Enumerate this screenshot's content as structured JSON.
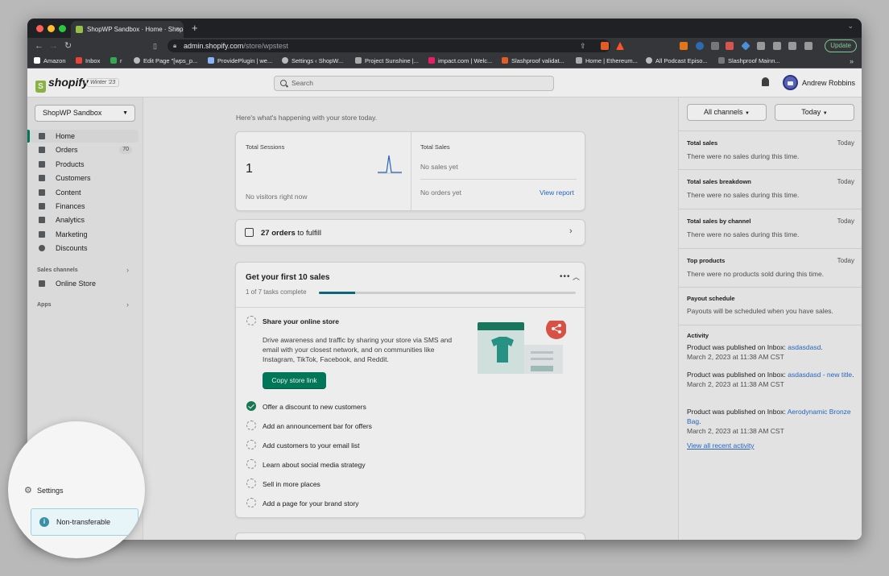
{
  "browser": {
    "tab_title": "ShopWP Sandbox · Home · Shop",
    "tab_close": "×",
    "new_tab": "+",
    "url_host": "admin.shopify.com",
    "url_path": "/store/wpstest",
    "update_label": "Update",
    "bookmarks": [
      "Amazon",
      "Inbox",
      "r",
      "Edit Page \"[wps_p...",
      "ProvidePlugin | we...",
      "Settings ‹ ShopW...",
      "Project Sunshine |...",
      "impact.com | Welc...",
      "Slashproof validat...",
      "Home | Ethereum...",
      "All Podcast Episo...",
      "Slashproof Mainn..."
    ],
    "more": "»"
  },
  "topbar": {
    "logo": "shopify",
    "edition": "Winter '23",
    "search_placeholder": "Search",
    "user_name": "Andrew Robbins"
  },
  "sidebar": {
    "store_name": "ShopWP Sandbox",
    "items": [
      {
        "label": "Home",
        "icon": "home-icon"
      },
      {
        "label": "Orders",
        "icon": "orders-icon",
        "count": "70"
      },
      {
        "label": "Products",
        "icon": "products-icon"
      },
      {
        "label": "Customers",
        "icon": "customers-icon"
      },
      {
        "label": "Content",
        "icon": "content-icon"
      },
      {
        "label": "Finances",
        "icon": "finances-icon"
      },
      {
        "label": "Analytics",
        "icon": "analytics-icon"
      },
      {
        "label": "Marketing",
        "icon": "marketing-icon"
      },
      {
        "label": "Discounts",
        "icon": "discounts-icon"
      }
    ],
    "sales_channels_label": "Sales channels",
    "online_store": "Online Store",
    "apps_label": "Apps",
    "settings": "Settings",
    "non_transferable": "Non-transferable"
  },
  "main": {
    "greeting": "Here's what's happening with your store today.",
    "sessions": {
      "label": "Total Sessions",
      "value": "1",
      "footer": "No visitors right now"
    },
    "sales": {
      "label": "Total Sales",
      "status": "No sales yet",
      "orders": "No orders yet",
      "view_report": "View report"
    },
    "fulfill": {
      "count": "27 orders",
      "suffix": "to fulfill"
    },
    "setup": {
      "title": "Get your first 10 sales",
      "progress_text": "1 of 7 tasks complete",
      "progress_pct": 14,
      "share_title": "Share your online store",
      "share_desc": "Drive awareness and traffic by sharing your store via SMS and email with your closest network, and on communities like Instagram, TikTok, Facebook, and Reddit.",
      "copy_button": "Copy store link",
      "tasks": [
        {
          "label": "Offer a discount to new customers",
          "done": true
        },
        {
          "label": "Add an announcement bar for offers",
          "done": false
        },
        {
          "label": "Add customers to your email list",
          "done": false
        },
        {
          "label": "Learn about social media strategy",
          "done": false
        },
        {
          "label": "Sell in more places",
          "done": false
        },
        {
          "label": "Add a page for your brand story",
          "done": false
        }
      ]
    }
  },
  "right": {
    "channels_button": "All channels",
    "date_button": "Today",
    "sections": [
      {
        "title": "Total sales",
        "period": "Today",
        "text": "There were no sales during this time."
      },
      {
        "title": "Total sales breakdown",
        "period": "Today",
        "text": "There were no sales during this time."
      },
      {
        "title": "Total sales by channel",
        "period": "Today",
        "text": "There were no sales during this time."
      },
      {
        "title": "Top products",
        "period": "Today",
        "text": "There were no products sold during this time."
      },
      {
        "title": "Payout schedule",
        "period": "",
        "text": "Payouts will be scheduled when you have sales."
      }
    ],
    "activity_title": "Activity",
    "activity": [
      {
        "prefix": "Product was published on Inbox:",
        "link": "asdasdasd",
        "end": ".",
        "date": "March 2, 2023 at 11:38 AM CST"
      },
      {
        "prefix": "Product was published on Inbox:",
        "link": "asdasdasd - new title",
        "end": ".",
        "date": "March 2, 2023 at 11:38 AM CST"
      },
      {
        "prefix": "Product was published on Inbox:",
        "link": "Aerodynamic Bronze Bag",
        "end": ".",
        "date": "March 2, 2023 at 11:38 AM CST"
      }
    ],
    "view_all": "View all recent activity"
  },
  "colors": {
    "accent": "#008060",
    "brand": "#95bf47",
    "link": "#2c6ecb",
    "progress": "#0c6f82"
  }
}
